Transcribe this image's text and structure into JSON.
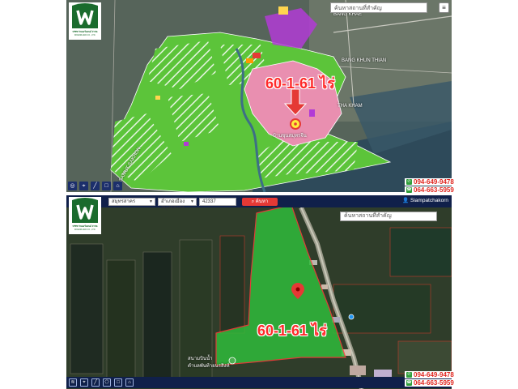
{
  "top_panel": {
    "search_placeholder": "ค้นหาสถานที่สำคัญ",
    "area_label": "60-1-61 ไร่",
    "place_labels": [
      "BANG KHAE",
      "BANG KHUN THIAN",
      "THA KHAM",
      "SAMUT SAKHON",
      "บ้านขุนสมุทรจีน"
    ],
    "menu_icon": "hamburger-icon",
    "toolbar_icons": [
      "gps-icon",
      "pin-icon",
      "line-icon",
      "square-icon",
      "home-icon"
    ]
  },
  "bottom_panel": {
    "navbar": {
      "province_select": "สมุทรสาคร",
      "district_select": "อำเภอเมืองสมุทรสาคร",
      "code_input": "42337",
      "search_button": "ค้นหา",
      "user": "Siampatchakorn"
    },
    "search_placeholder": "ค้นหาสถานที่สำคัญ",
    "area_label": "60-1-61 ไร่",
    "place_labels": [
      "สนามบินน้ำ",
      "ตำบลพันท้ายนรสิงห์"
    ],
    "toolbar_icons": [
      "layers-icon",
      "pin-icon",
      "line-icon",
      "polygon-icon",
      "square-icon",
      "home-icon"
    ]
  },
  "logo": {
    "caption": "บริษัท วินแอร์แลนด์ จำกัด",
    "subcaption": "WINAIRLAND CO., LTD."
  },
  "phones": [
    "094-649-9478",
    "064-663-5959"
  ],
  "colors": {
    "zone_green": "#5cc43a",
    "zone_pink": "#e98fb0",
    "label_red": "#ff2a2a",
    "navbar": "#10204a",
    "logo_green": "#1a6b2d"
  }
}
